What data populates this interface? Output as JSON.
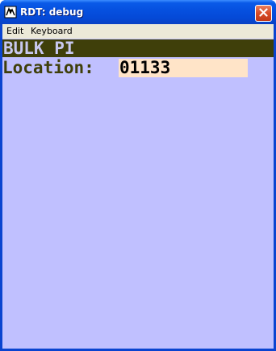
{
  "window": {
    "title": "RDT: debug",
    "icon": "rdt-app-icon",
    "close_icon": "close-icon"
  },
  "menu": {
    "items": [
      {
        "label": "Edit"
      },
      {
        "label": "Keyboard"
      }
    ]
  },
  "screen": {
    "title": "BULK PI",
    "location_label": "Location:",
    "location_value": "01133"
  },
  "colors": {
    "client_background": "#c0c0ff",
    "header_bar": "#3f3f0a",
    "header_text": "#c8c8f0",
    "label_text": "#3f3f0a",
    "input_background": "#ffe4c8"
  }
}
